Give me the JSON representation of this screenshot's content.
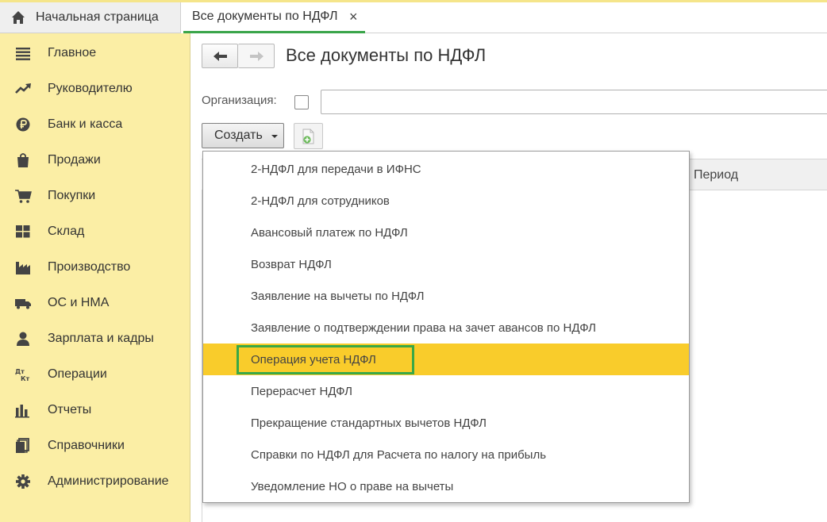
{
  "tabs": {
    "home_label": "Начальная страница",
    "active_label": "Все документы по НДФЛ",
    "close_glyph": "×"
  },
  "sidebar": {
    "items": [
      {
        "label": "Главное",
        "icon": "menu-lines-icon"
      },
      {
        "label": "Руководителю",
        "icon": "trend-up-icon"
      },
      {
        "label": "Банк и касса",
        "icon": "ruble-coin-icon"
      },
      {
        "label": "Продажи",
        "icon": "shopping-bag-icon"
      },
      {
        "label": "Покупки",
        "icon": "cart-icon"
      },
      {
        "label": "Склад",
        "icon": "warehouse-grid-icon"
      },
      {
        "label": "Производство",
        "icon": "factory-icon"
      },
      {
        "label": "ОС и НМА",
        "icon": "truck-icon"
      },
      {
        "label": "Зарплата и кадры",
        "icon": "person-icon"
      },
      {
        "label": "Операции",
        "icon": "debit-credit-icon"
      },
      {
        "label": "Отчеты",
        "icon": "bar-chart-icon"
      },
      {
        "label": "Справочники",
        "icon": "books-icon"
      },
      {
        "label": "Администрирование",
        "icon": "gear-icon"
      }
    ],
    "debit_credit_glyph": {
      "top": "Дт",
      "bottom": "Кт"
    }
  },
  "main": {
    "title": "Все документы по НДФЛ",
    "org_label": "Организация:",
    "org_value": "",
    "create_label": "Создать",
    "period_header": "Период"
  },
  "dropdown": {
    "items": [
      "2-НДФЛ для передачи в ИФНС",
      "2-НДФЛ для сотрудников",
      "Авансовый платеж по НДФЛ",
      "Возврат НДФЛ",
      "Заявление на вычеты по НДФЛ",
      "Заявление о подтверждении права на зачет авансов по НДФЛ",
      "Операция учета НДФЛ",
      "Перерасчет НДФЛ",
      "Прекращение стандартных вычетов НДФЛ",
      "Справки по НДФЛ для Расчета по налогу на прибыль",
      "Уведомление НО о праве на вычеты"
    ],
    "highlighted_index": 6
  },
  "colors": {
    "sidebar_bg": "#fbeea5",
    "highlight": "#f9cc2b",
    "focus_green": "#39a847",
    "tab_underline": "#3aa54a"
  }
}
